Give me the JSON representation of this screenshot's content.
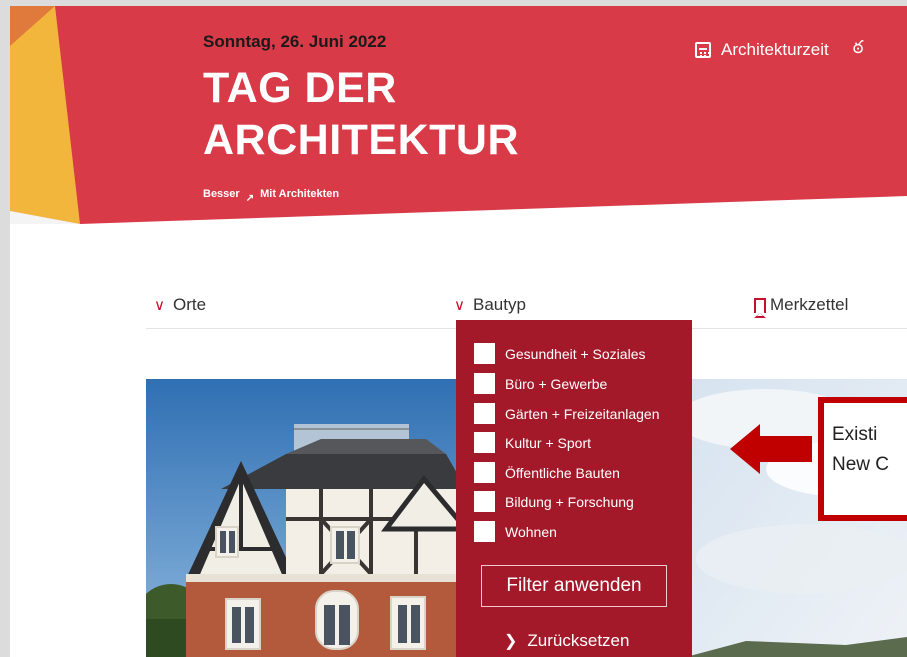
{
  "header": {
    "date": "Sonntag, 26. Juni 2022",
    "title_line1": "TAG DER",
    "title_line2": "ARCHITEKTUR",
    "tagline_left": "Besser",
    "tagline_arrow": "↗",
    "tagline_right": "Mit Architekten",
    "nav_link": "Architekturzeit",
    "bike_icon": "bike-icon",
    "calendar_icon": "calendar-icon"
  },
  "filters": {
    "orte": "Orte",
    "bautyp": "Bautyp",
    "merkzettel": "Merkzettel"
  },
  "dropdown": {
    "options": [
      "Gesundheit + Soziales",
      "Büro + Gewerbe",
      "Gärten + Freizeitanlagen",
      "Kultur + Sport",
      "Öffentliche Bauten",
      "Bildung + Forschung",
      "Wohnen"
    ],
    "apply_label": "Filter anwenden",
    "reset_label": "Zurücksetzen"
  },
  "annotation": {
    "line1": "Existi",
    "line2": "New C"
  },
  "colors": {
    "brand_red": "#d93a47",
    "dropdown_red": "#a4192a",
    "accent_yellow": "#f2b63c",
    "annotation_red": "#c00000"
  }
}
